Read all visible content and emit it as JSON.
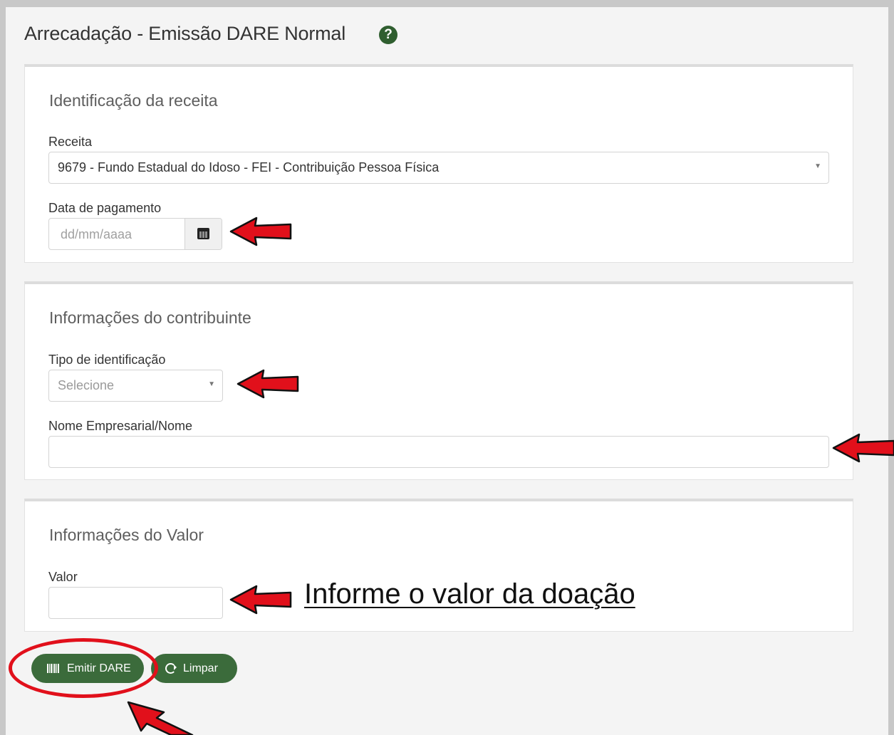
{
  "page": {
    "title": "Arrecadação - Emissão DARE Normal",
    "help_icon": "question-circle-icon"
  },
  "receita_panel": {
    "heading": "Identificação da receita",
    "receita_label": "Receita",
    "receita_value": "9679 - Fundo Estadual do Idoso - FEI - Contribuição Pessoa Física",
    "data_label": "Data de pagamento",
    "data_placeholder": "dd/mm/aaaa",
    "calendar_icon": "calendar-icon"
  },
  "contribuinte_panel": {
    "heading": "Informações do contribuinte",
    "tipo_label": "Tipo de identificação",
    "tipo_placeholder": "Selecione",
    "nome_label": "Nome Empresarial/Nome",
    "nome_value": ""
  },
  "valor_panel": {
    "heading": "Informações do Valor",
    "valor_label": "Valor",
    "valor_value": ""
  },
  "actions": {
    "emitir_label": "Emitir DARE",
    "limpar_label": "Limpar"
  },
  "annotations": {
    "valor_hint": "Informe o valor da doação",
    "arrow_color": "#e1101b",
    "accent_green": "#3b6b3b"
  }
}
